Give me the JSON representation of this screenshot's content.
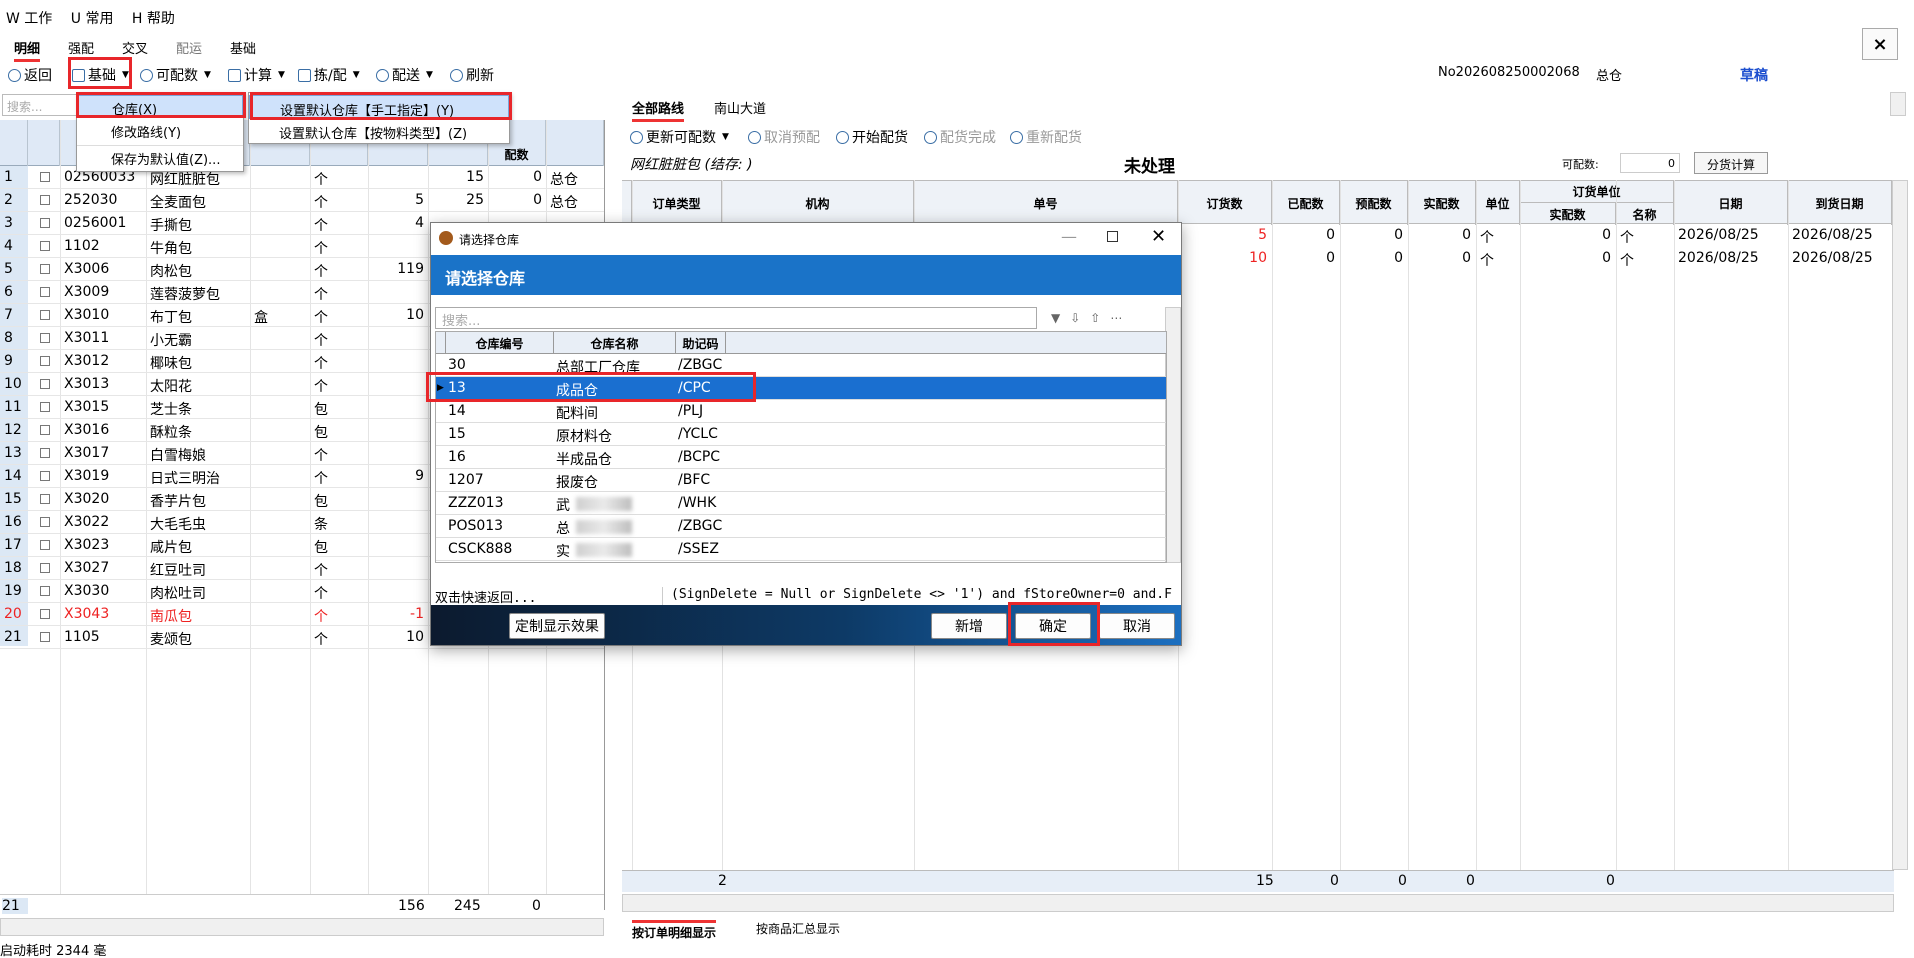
{
  "menubar": {
    "items": [
      "W 工作",
      "U 常用",
      "H 帮助"
    ]
  },
  "tabs": [
    "明细",
    "强配",
    "交叉",
    "配运",
    "基础"
  ],
  "close_label": "×",
  "toolbar": {
    "back": "返回",
    "basic": "基础",
    "allocatable": "可配数",
    "calc": "计算",
    "pick": "拣/配",
    "dispatch": "配送",
    "refresh": "刷新",
    "doc_no": "No202608250002068",
    "warehouse": "总仓",
    "state": "草稿"
  },
  "left": {
    "search_placeholder": "搜索...",
    "header_partial": "配数",
    "rows": [
      {
        "n": "1",
        "code": "02560033",
        "name": "网红脏脏包",
        "box": "",
        "unit": "个",
        "q1": "",
        "q2": "15",
        "q3": "0",
        "wh": "总仓"
      },
      {
        "n": "2",
        "code": "252030",
        "name": "全麦面包",
        "box": "",
        "unit": "个",
        "q1": "5",
        "q2": "25",
        "q3": "0",
        "wh": "总仓"
      },
      {
        "n": "3",
        "code": "0256001",
        "name": "手撕包",
        "box": "",
        "unit": "个",
        "q1": "4",
        "q2": "",
        "q3": "",
        "wh": ""
      },
      {
        "n": "4",
        "code": "1102",
        "name": "牛角包",
        "box": "",
        "unit": "个",
        "q1": "",
        "q2": "",
        "q3": "",
        "wh": ""
      },
      {
        "n": "5",
        "code": "X3006",
        "name": "肉松包",
        "box": "",
        "unit": "个",
        "q1": "119",
        "q2": "",
        "q3": "",
        "wh": ""
      },
      {
        "n": "6",
        "code": "X3009",
        "name": "莲蓉菠萝包",
        "box": "",
        "unit": "个",
        "q1": "",
        "q2": "",
        "q3": "",
        "wh": ""
      },
      {
        "n": "7",
        "code": "X3010",
        "name": "布丁包",
        "box": "盒",
        "unit": "个",
        "q1": "10",
        "q2": "",
        "q3": "",
        "wh": ""
      },
      {
        "n": "8",
        "code": "X3011",
        "name": "小无霸",
        "box": "",
        "unit": "个",
        "q1": "",
        "q2": "",
        "q3": "",
        "wh": ""
      },
      {
        "n": "9",
        "code": "X3012",
        "name": "椰味包",
        "box": "",
        "unit": "个",
        "q1": "",
        "q2": "",
        "q3": "",
        "wh": ""
      },
      {
        "n": "10",
        "code": "X3013",
        "name": "太阳花",
        "box": "",
        "unit": "个",
        "q1": "",
        "q2": "",
        "q3": "",
        "wh": ""
      },
      {
        "n": "11",
        "code": "X3015",
        "name": "芝士条",
        "box": "",
        "unit": "包",
        "q1": "",
        "q2": "",
        "q3": "",
        "wh": ""
      },
      {
        "n": "12",
        "code": "X3016",
        "name": "酥粒条",
        "box": "",
        "unit": "包",
        "q1": "",
        "q2": "",
        "q3": "",
        "wh": ""
      },
      {
        "n": "13",
        "code": "X3017",
        "name": "白雪梅娘",
        "box": "",
        "unit": "个",
        "q1": "",
        "q2": "",
        "q3": "",
        "wh": ""
      },
      {
        "n": "14",
        "code": "X3019",
        "name": "日式三明治",
        "box": "",
        "unit": "个",
        "q1": "9",
        "q2": "",
        "q3": "",
        "wh": ""
      },
      {
        "n": "15",
        "code": "X3020",
        "name": "香芋片包",
        "box": "",
        "unit": "包",
        "q1": "",
        "q2": "",
        "q3": "",
        "wh": ""
      },
      {
        "n": "16",
        "code": "X3022",
        "name": "大毛毛虫",
        "box": "",
        "unit": "条",
        "q1": "",
        "q2": "",
        "q3": "",
        "wh": ""
      },
      {
        "n": "17",
        "code": "X3023",
        "name": "咸片包",
        "box": "",
        "unit": "包",
        "q1": "",
        "q2": "",
        "q3": "",
        "wh": ""
      },
      {
        "n": "18",
        "code": "X3027",
        "name": "红豆吐司",
        "box": "",
        "unit": "个",
        "q1": "",
        "q2": "",
        "q3": "",
        "wh": ""
      },
      {
        "n": "19",
        "code": "X3030",
        "name": "肉松吐司",
        "box": "",
        "unit": "个",
        "q1": "",
        "q2": "",
        "q3": "",
        "wh": ""
      },
      {
        "n": "20",
        "code": "X3043",
        "name": "南瓜包",
        "box": "",
        "unit": "个",
        "q1": "-1",
        "q2": "",
        "q3": "",
        "wh": "",
        "red": true
      },
      {
        "n": "21",
        "code": "1105",
        "name": "麦颂包",
        "box": "",
        "unit": "个",
        "q1": "10",
        "q2": "",
        "q3": "",
        "wh": ""
      }
    ],
    "footer": {
      "count": "21",
      "q1": "156",
      "q2": "245",
      "q3": "0"
    },
    "status": "启动耗时 2344 毫"
  },
  "menu1": {
    "items": [
      "仓库(X)",
      "修改路线(Y)",
      "保存为默认值(Z)..."
    ]
  },
  "menu2": {
    "items": [
      "设置默认仓库【手工指定】(Y)",
      "设置默认仓库【按物料类型】(Z)"
    ]
  },
  "right": {
    "tabs": [
      "全部路线",
      "南山大道"
    ],
    "toolbar": [
      "更新可配数",
      "取消预配",
      "开始配货",
      "配货完成",
      "重新配货"
    ],
    "subtitle": "网红脏脏包 (结存: )",
    "state": "未处理",
    "allocatable_label": "可配数:",
    "allocatable_value": "0",
    "split_button": "分货计算",
    "headers": [
      "订单类型",
      "机构",
      "单号",
      "订货数",
      "已配数",
      "预配数",
      "实配数",
      "单位",
      "订货单位",
      "实配数",
      "名称",
      "日期",
      "到货日期"
    ],
    "rows": [
      {
        "order": "5",
        "alloc": "0",
        "pre": "0",
        "real": "0",
        "unit": "个",
        "ou_real": "0",
        "ou_name": "个",
        "date": "2026/08/25",
        "arrive": "2026/08/25"
      },
      {
        "order": "10",
        "alloc": "0",
        "pre": "0",
        "real": "0",
        "unit": "个",
        "ou_real": "0",
        "ou_name": "个",
        "date": "2026/08/25",
        "arrive": "2026/08/25"
      }
    ],
    "footer": {
      "count": "2",
      "order": "15",
      "alloc": "0",
      "pre": "0",
      "real": "0",
      "ou_real": "0"
    },
    "bottom_tabs": [
      "按订单明细显示",
      "按商品汇总显示"
    ]
  },
  "dialog": {
    "title": "请选择仓库",
    "header": "请选择仓库",
    "search_placeholder": "搜索...",
    "columns": [
      "仓库编号",
      "仓库名称",
      "助记码"
    ],
    "rows": [
      {
        "code": "30",
        "name": "总部工厂仓库",
        "memo": "/ZBGC",
        "blur": false
      },
      {
        "code": "13",
        "name": "成品仓",
        "memo": "/CPC",
        "blur": false,
        "selected": true
      },
      {
        "code": "14",
        "name": "配料间",
        "memo": "/PLJ",
        "blur": false
      },
      {
        "code": "15",
        "name": "原材料仓",
        "memo": "/YCLC",
        "blur": false
      },
      {
        "code": "16",
        "name": "半成品仓",
        "memo": "/BCPC",
        "blur": false
      },
      {
        "code": "1207",
        "name": "报废仓",
        "memo": "/BFC",
        "blur": false
      },
      {
        "code": "ZZZ013",
        "name": "武",
        "memo": "/WHK",
        "blur": true
      },
      {
        "code": "POS013",
        "name": "总",
        "memo": "/ZBGC",
        "blur": true
      },
      {
        "code": "CSCK888",
        "name": "实",
        "memo": "/SSEZ",
        "blur": true
      }
    ],
    "status_left": "双击快速返回...",
    "status_right": "(SignDelete = Null or SignDelete <> '1') and fStoreOwner=0 and.F",
    "buttons": {
      "custom": "定制显示效果",
      "add": "新增",
      "ok": "确定",
      "cancel": "取消"
    }
  },
  "colors": {
    "highlight_red": "#e8262a",
    "selection_blue": "#1a6fd0",
    "header_blue": "#1a73c8"
  }
}
